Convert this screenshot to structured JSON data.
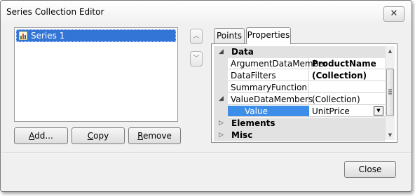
{
  "window": {
    "title": "Series Collection Editor",
    "close_glyph": "✕"
  },
  "series_list": {
    "items": [
      {
        "label": "Series 1",
        "icon": "bar-chart-icon"
      }
    ]
  },
  "buttons": {
    "add": {
      "key": "A",
      "rest": "dd..."
    },
    "copy": {
      "key": "C",
      "rest": "opy"
    },
    "remove": {
      "key": "R",
      "rest": "emove"
    },
    "close": "Close",
    "move_up_glyph": "︿",
    "move_down_glyph": "﹀"
  },
  "tabs": [
    {
      "label": "Points"
    },
    {
      "label": "Properties",
      "active": true
    }
  ],
  "properties": {
    "data_category": "Data",
    "rows": [
      {
        "name": "ArgumentDataMember",
        "value": "ProductName"
      },
      {
        "name": "DataFilters",
        "value": "(Collection)"
      },
      {
        "name": "SummaryFunction",
        "value": ""
      },
      {
        "name": "ValueDataMembers",
        "value": "(Collection)"
      },
      {
        "name": "Value",
        "value": "UnitPrice"
      }
    ],
    "elements_category": "Elements",
    "misc_category": "Misc"
  },
  "colors": {
    "selection": "#3375d7",
    "grid_selection": "#3d8ee8"
  }
}
